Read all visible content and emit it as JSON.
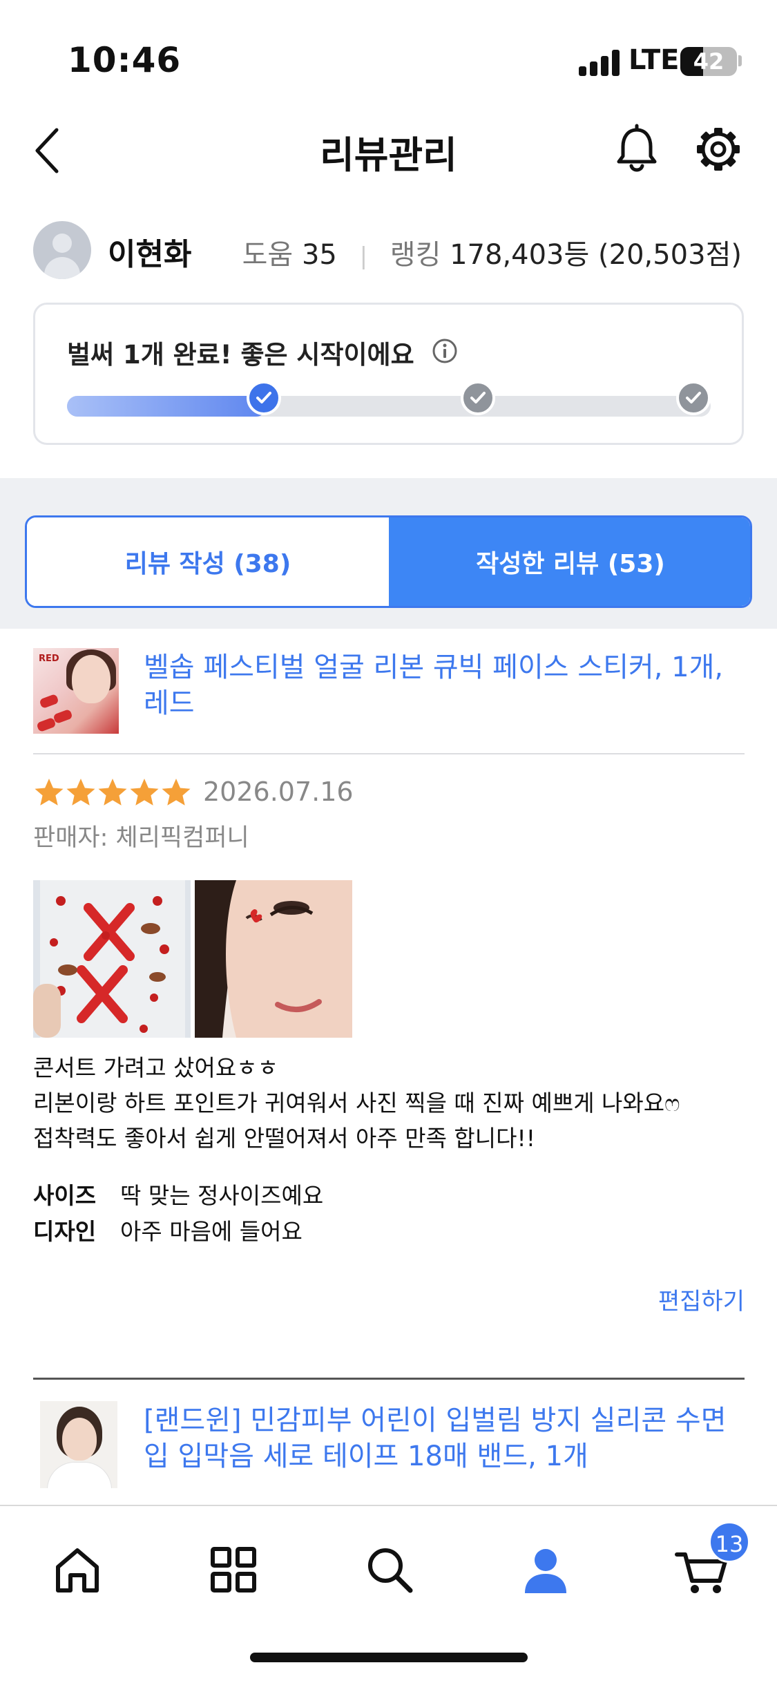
{
  "status_bar": {
    "time": "10:46",
    "network": "LTE",
    "battery": "42"
  },
  "header": {
    "title": "리뷰관리"
  },
  "profile": {
    "name": "이현화",
    "help_label": "도움",
    "help_value": "35",
    "ranking_label": "랭킹",
    "ranking_value": "178,403등 (20,503점)"
  },
  "progress": {
    "message": "벌써 1개 완료! 좋은 시작이에요",
    "completed_steps": 1,
    "total_steps": 3,
    "fill_fraction": 0.31
  },
  "tabs": [
    {
      "label": "리뷰 작성 (38)",
      "active": false
    },
    {
      "label": "작성한 리뷰 (53)",
      "active": true
    }
  ],
  "reviews": [
    {
      "product_title": "벨솝 페스티벌 얼굴 리본 큐빅 페이스 스티커, 1개, 레드",
      "thumb_text": "RED",
      "rating": 5,
      "date": "2026.07.16",
      "seller": "판매자: 체리픽컴퍼니",
      "body": "콘서트 가려고 샀어요ㅎㅎ\n리본이랑 하트 포인트가 귀여워서 사진 찍을 때 진짜 예쁘게 나와요ෆ\n접착력도 좋아서 쉽게 안떨어져서 아주 만족 합니다!!",
      "attributes": [
        {
          "key": "사이즈",
          "value": "딱 맞는 정사이즈예요"
        },
        {
          "key": "디자인",
          "value": "아주 마음에 들어요"
        }
      ],
      "edit_label": "편집하기"
    },
    {
      "product_title": "[랜드윈] 민감피부 어린이 입벌림 방지 실리콘 수면 입 입막음 세로 테이프 18매 밴드, 1개"
    }
  ],
  "bottom_nav": {
    "items": [
      "home-icon",
      "category-icon",
      "search-icon",
      "my-page-icon",
      "cart-icon"
    ],
    "cart_badge": "13"
  },
  "colors": {
    "accent": "#3d78ee",
    "star": "#f5a038",
    "active_tab": "#3d86f5"
  }
}
